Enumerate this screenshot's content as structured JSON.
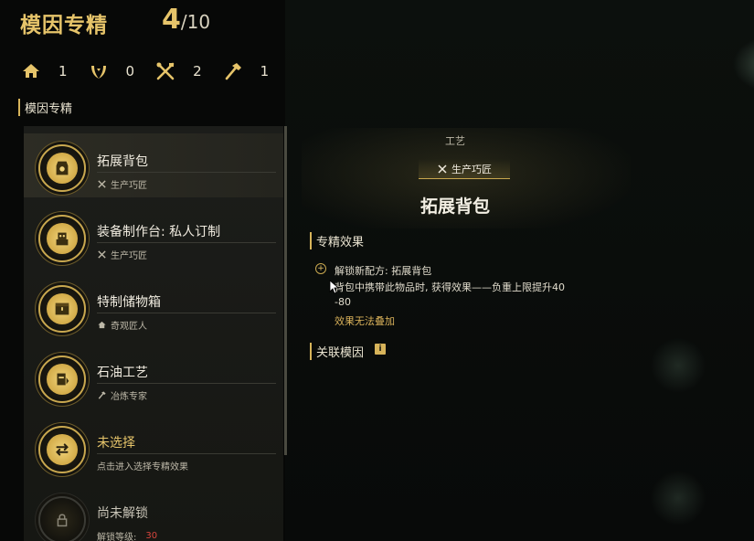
{
  "header": {
    "title": "模因专精",
    "count_current": "4",
    "count_total": "/10"
  },
  "stats": [
    {
      "icon": "house-icon",
      "value": "1"
    },
    {
      "icon": "laurel-icon",
      "value": "0"
    },
    {
      "icon": "crossed-tools-icon",
      "value": "2"
    },
    {
      "icon": "hammer-icon",
      "value": "1"
    }
  ],
  "section_label": "模因专精",
  "items": [
    {
      "name": "拓展背包",
      "sub": "生产巧匠",
      "sub_icon": "crossed-tools-icon",
      "icon": "badge-icon"
    },
    {
      "name": "装备制作台: 私人订制",
      "sub": "生产巧匠",
      "sub_icon": "crossed-tools-icon",
      "icon": "robot-icon"
    },
    {
      "name": "特制储物箱",
      "sub": "奇观匠人",
      "sub_icon": "house-icon",
      "icon": "chest-icon"
    },
    {
      "name": "石油工艺",
      "sub": "冶炼专家",
      "sub_icon": "hammer-icon",
      "icon": "oil-icon"
    },
    {
      "name": "未选择",
      "sub": "点击进入选择专精效果",
      "icon": "swap-icon"
    },
    {
      "name": "尚未解锁",
      "sub": "解锁等级:",
      "level": "30",
      "icon": "lock-icon"
    }
  ],
  "detail": {
    "category": "工艺",
    "tag": "生产巧匠",
    "title": "拓展背包",
    "effect_heading": "专精效果",
    "effect_line1": "解锁新配方: 拓展背包",
    "effect_line2": "背包中携带此物品时, 获得效果——负重上限提升40",
    "effect_line3": "-80",
    "effect_note": "效果无法叠加",
    "related_heading": "关联模因",
    "related_badge": "i"
  },
  "colors": {
    "gold": "#e6c46a",
    "accent": "#d7b45a",
    "lock_red": "#d8453d"
  }
}
